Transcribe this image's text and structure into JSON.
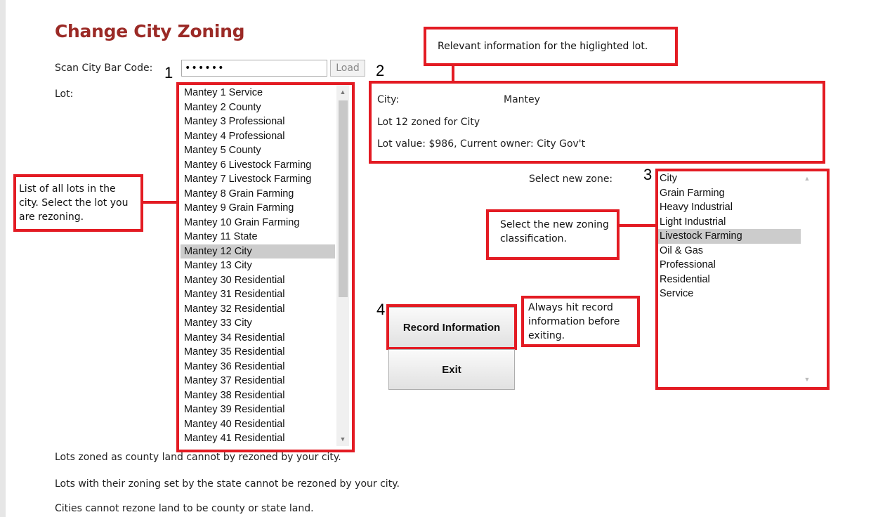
{
  "page": {
    "title": "Change City Zoning",
    "barcode_label": "Scan City Bar Code:",
    "barcode_value": "••••••",
    "load_label": "Load",
    "lot_label": "Lot:",
    "select_zone_label": "Select new zone:"
  },
  "markers": {
    "m1": "1",
    "m2": "2",
    "m3": "3",
    "m4": "4"
  },
  "lots": [
    "Mantey 1 Service",
    "Mantey 2 County",
    "Mantey 3 Professional",
    "Mantey 4 Professional",
    "Mantey 5 County",
    "Mantey 6 Livestock Farming",
    "Mantey 7 Livestock Farming",
    "Mantey 8 Grain Farming",
    "Mantey 9 Grain Farming",
    "Mantey 10 Grain Farming",
    "Mantey 11 State",
    "Mantey 12 City",
    "Mantey 13 City",
    "Mantey 30 Residential",
    "Mantey 31 Residential",
    "Mantey 32 Residential",
    "Mantey 33 City",
    "Mantey 34 Residential",
    "Mantey 35 Residential",
    "Mantey 36 Residential",
    "Mantey 37 Residential",
    "Mantey 38 Residential",
    "Mantey 39 Residential",
    "Mantey 40 Residential",
    "Mantey 41 Residential"
  ],
  "selected_lot_index": 11,
  "info": {
    "city_label": "City:",
    "city_value": "Mantey",
    "zoned_line": "Lot 12 zoned for City",
    "value_line": "Lot value: $986, Current owner: City Gov't"
  },
  "zones": [
    "City",
    "Grain Farming",
    "Heavy Industrial",
    "Light Industrial",
    "Livestock Farming",
    "Oil & Gas",
    "Professional",
    "Residential",
    "Service"
  ],
  "selected_zone_index": 4,
  "buttons": {
    "record": "Record Information",
    "exit": "Exit"
  },
  "callouts": {
    "relevant_info": "Relevant information for the higlighted lot.",
    "list_of_lots": "List of all lots in the city. Select the lot you are rezoning.",
    "select_zoning": "Select the new zoning classification.",
    "always_record": "Always hit record information before exiting."
  },
  "notes": [
    "Lots zoned as county land cannot by rezoned by your city.",
    "Lots with their zoning set by the state cannot be rezoned by your city.",
    "Cities cannot rezone land to be county or state land."
  ],
  "colors": {
    "title": "#9b2a26",
    "callout_border": "#e31b23",
    "selection": "#cccccc"
  }
}
